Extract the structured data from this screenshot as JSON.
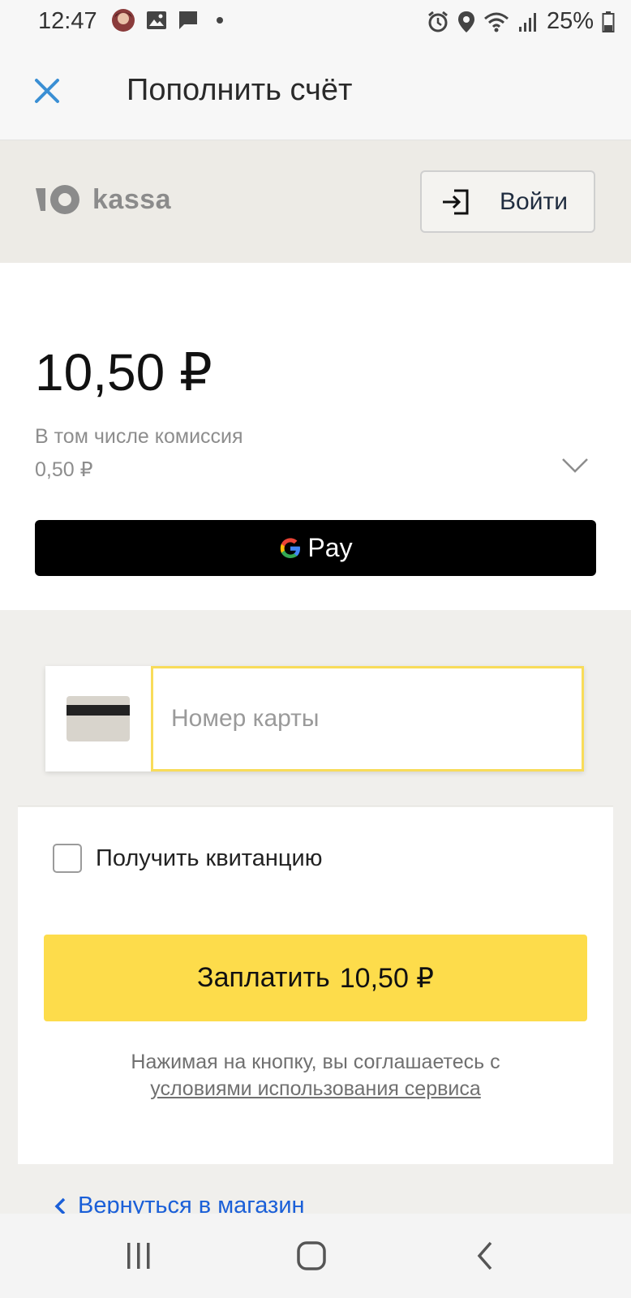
{
  "status_bar": {
    "time": "12:47",
    "battery": "25%",
    "icons": [
      "avatar-icon",
      "gallery-icon",
      "message-icon",
      "dot-icon",
      "alarm-icon",
      "location-icon",
      "wifi-icon",
      "signal-icon",
      "battery-icon"
    ]
  },
  "app_bar": {
    "title": "Пополнить счёт",
    "close_icon": "close-icon"
  },
  "kassa": {
    "logo_text": "kassa",
    "login_label": "Войти"
  },
  "summary": {
    "amount": "10,50 ₽",
    "commission_label": "В том числе комиссия",
    "commission_value": "0,50 ₽"
  },
  "gpay": {
    "label": "Pay"
  },
  "card": {
    "placeholder": "Номер карты"
  },
  "receipt": {
    "label": "Получить квитанцию",
    "checked": false
  },
  "pay_button": {
    "label": "Заплатить",
    "amount": "10,50 ₽"
  },
  "terms": {
    "text": "Нажимая на кнопку, вы соглашаетесь с",
    "link": "условиями использования сервиса"
  },
  "back_link": {
    "label": "Вернуться в магазин"
  },
  "colors": {
    "accent_yellow": "#fddc4b",
    "input_focus": "#f8dc5a",
    "link_blue": "#1a5fd8",
    "close_blue": "#3a8fd4"
  }
}
